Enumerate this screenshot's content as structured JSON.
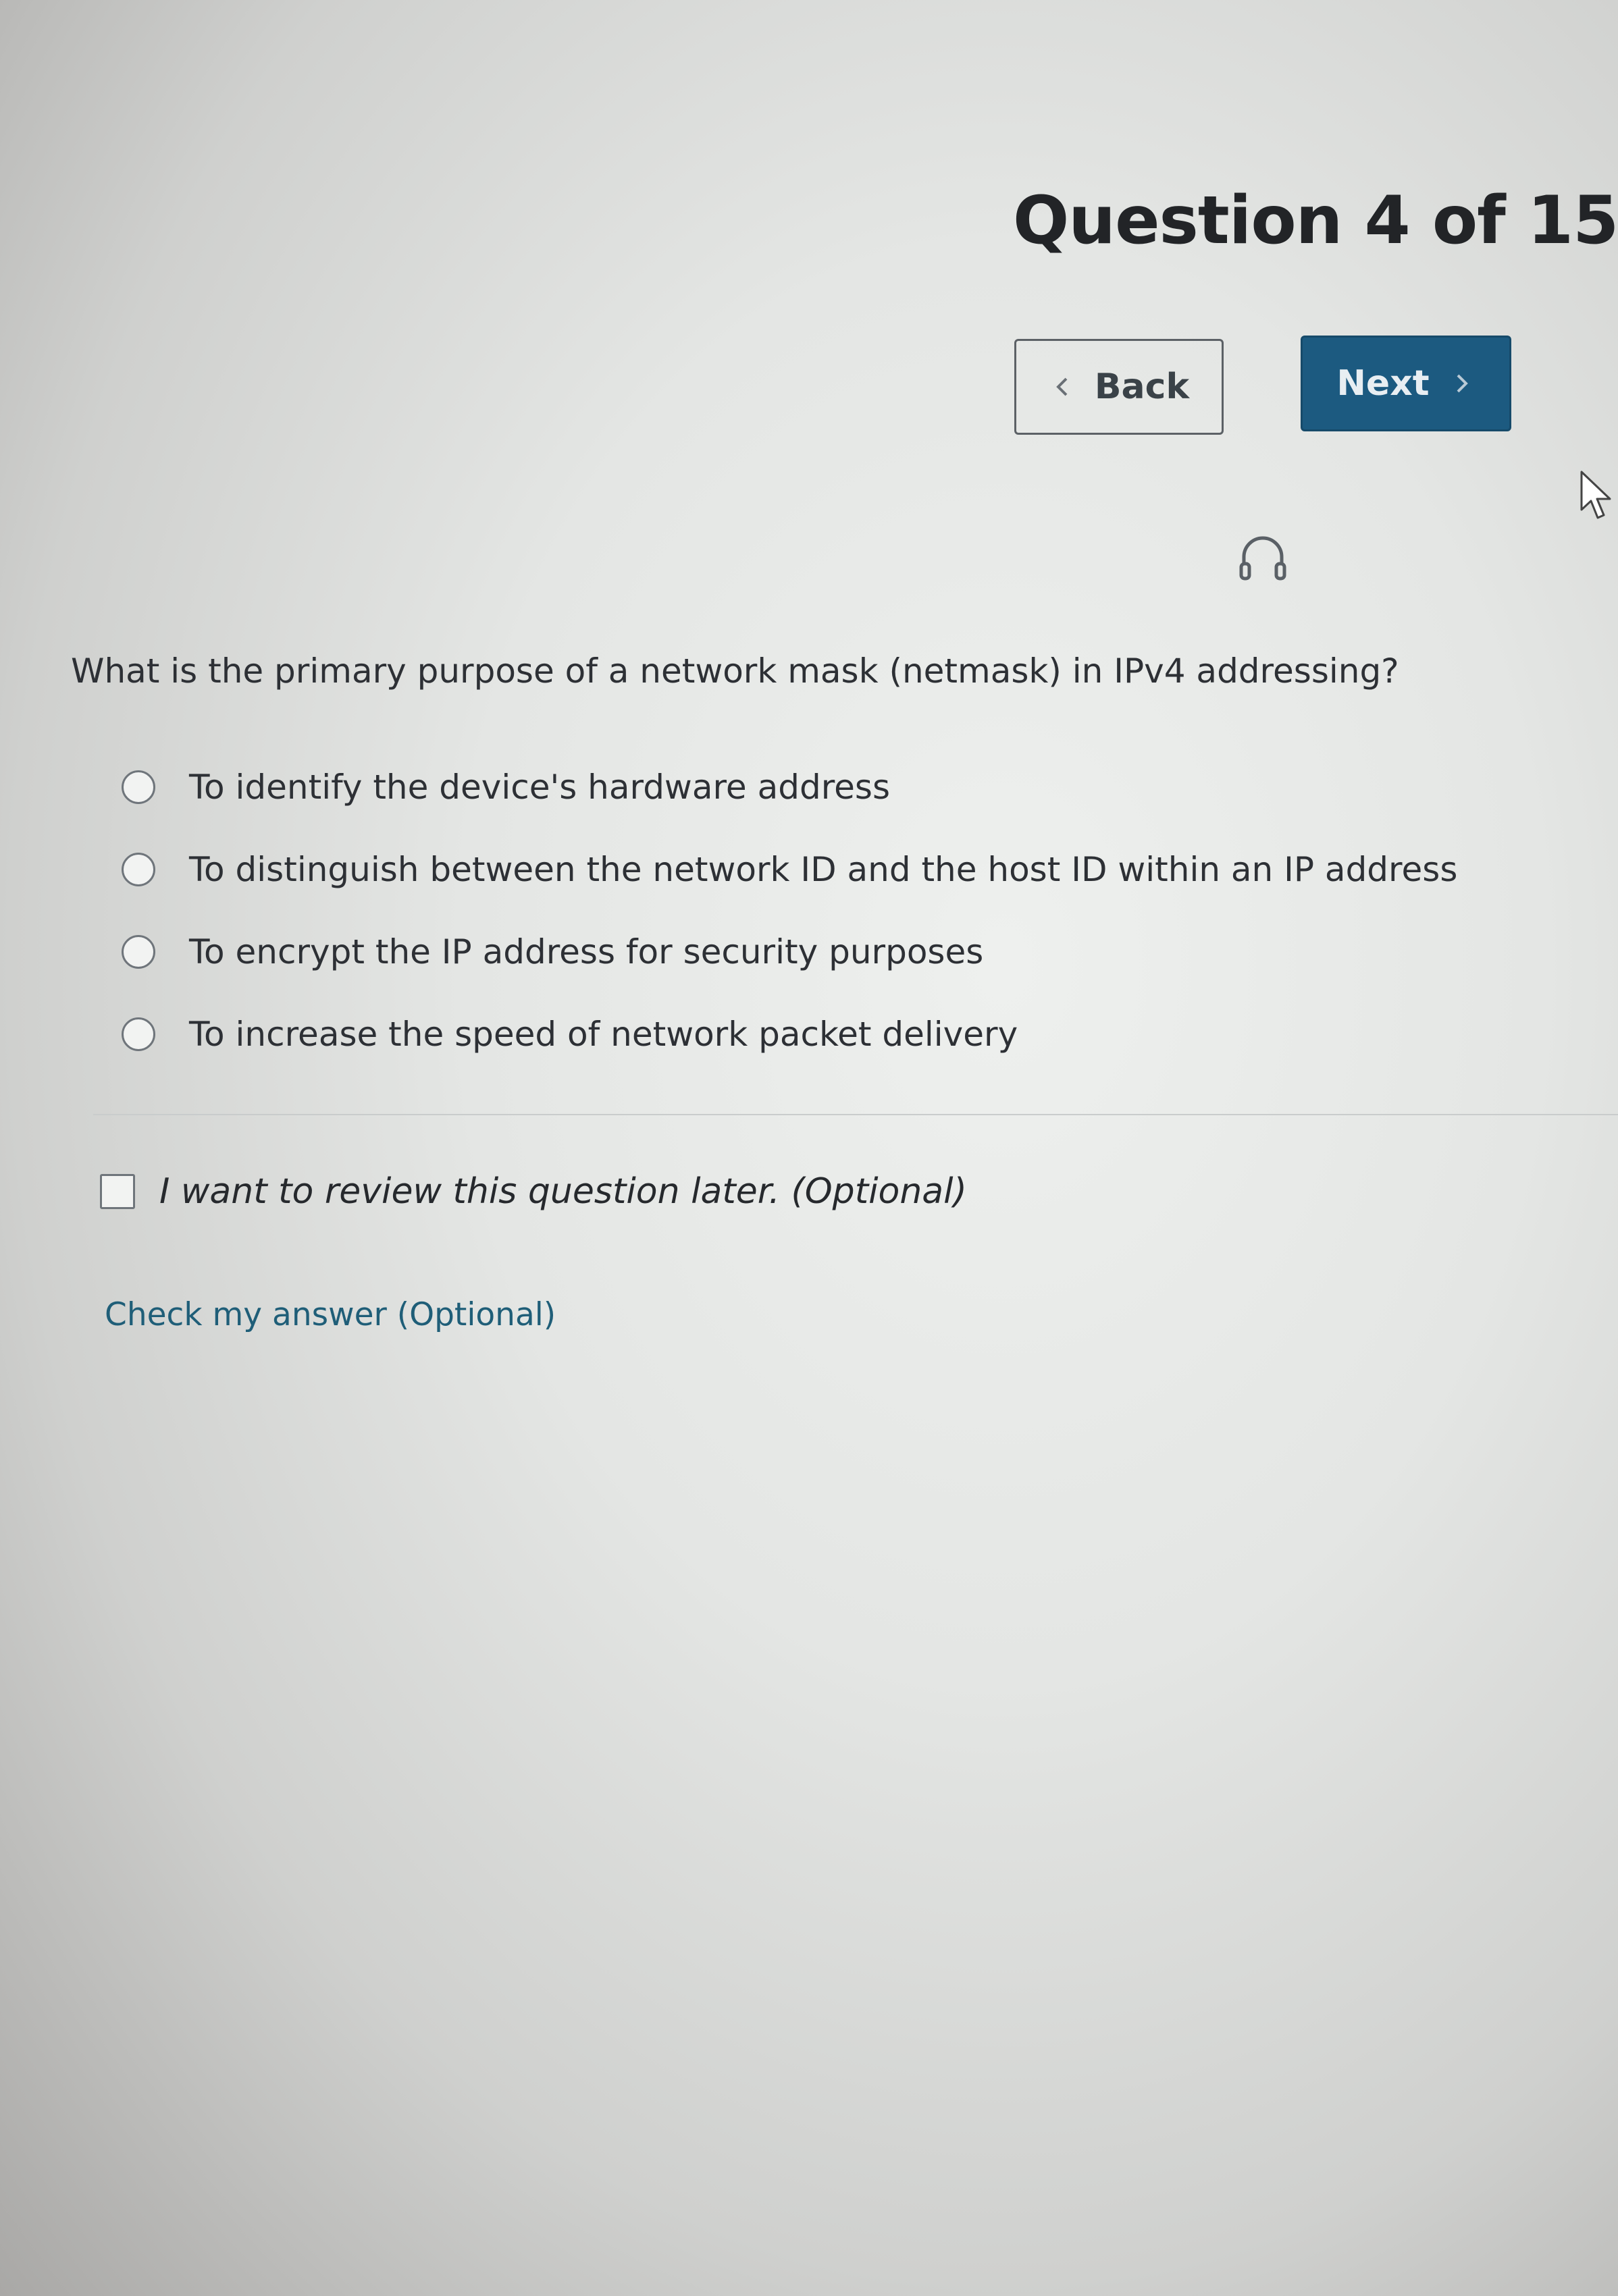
{
  "header": {
    "title": "Question 4 of 15"
  },
  "navigation": {
    "back_label": "Back",
    "next_label": "Next",
    "next_color": "#1c5a80"
  },
  "icons": {
    "audio": "headphones-icon",
    "back": "chevron-left-icon",
    "next": "chevron-right-icon",
    "pointer": "mouse-cursor-icon"
  },
  "question": {
    "text": "What is the primary purpose of a network mask (netmask) in IPv4 addressing?",
    "options": [
      {
        "label": "To identify the device's hardware address",
        "selected": false
      },
      {
        "label": "To distinguish between the network ID and the host ID within an IP address",
        "selected": false
      },
      {
        "label": "To encrypt the IP address for security purposes",
        "selected": false
      },
      {
        "label": "To increase the speed of network packet delivery",
        "selected": false
      }
    ]
  },
  "review": {
    "label": "I want to review this question later. (Optional)",
    "checked": false
  },
  "check_answer": {
    "label": "Check my answer (Optional)"
  }
}
